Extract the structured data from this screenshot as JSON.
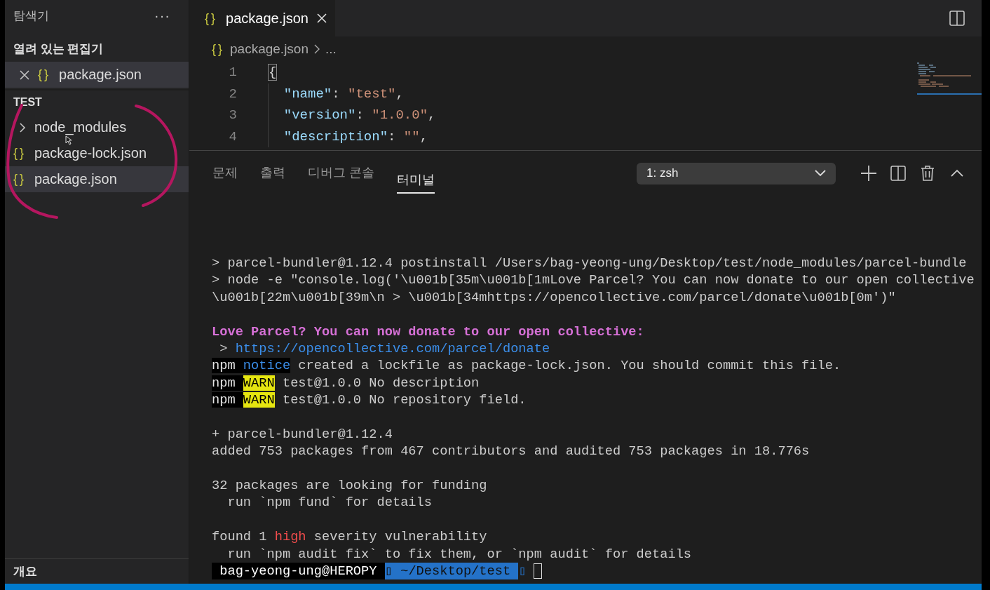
{
  "sidebar": {
    "title": "탐색기",
    "more": "···",
    "open_editors": {
      "title": "열려 있는 편집기",
      "items": [
        {
          "icon": "{}",
          "label": "package.json",
          "selected": true
        }
      ]
    },
    "folder": {
      "title": "TEST",
      "items": [
        {
          "kind": "folder",
          "label": "node_modules",
          "expanded": false,
          "selected": false
        },
        {
          "kind": "file",
          "icon": "{}",
          "label": "package-lock.json",
          "selected": false
        },
        {
          "kind": "file",
          "icon": "{}",
          "label": "package.json",
          "selected": true
        }
      ]
    },
    "outline": {
      "title": "개요"
    }
  },
  "editor": {
    "tabs": [
      {
        "icon": "{}",
        "label": "package.json",
        "selected": true
      }
    ],
    "breadcrumb": {
      "icon": "{}",
      "file": "package.json",
      "rest": "..."
    },
    "lines": [
      {
        "number": "1",
        "tokens": [
          {
            "kind": "bracket-match",
            "text": "{"
          }
        ]
      },
      {
        "number": "2",
        "tokens": [
          {
            "kind": "key",
            "text": "  \"name\""
          },
          {
            "kind": "punct",
            "text": ": "
          },
          {
            "kind": "string",
            "text": "\"test\""
          },
          {
            "kind": "punct",
            "text": ","
          }
        ]
      },
      {
        "number": "3",
        "tokens": [
          {
            "kind": "key",
            "text": "  \"version\""
          },
          {
            "kind": "punct",
            "text": ": "
          },
          {
            "kind": "string",
            "text": "\"1.0.0\""
          },
          {
            "kind": "punct",
            "text": ","
          }
        ]
      },
      {
        "number": "4",
        "tokens": [
          {
            "kind": "key",
            "text": "  \"description\""
          },
          {
            "kind": "punct",
            "text": ": "
          },
          {
            "kind": "string",
            "text": "\"\""
          },
          {
            "kind": "punct",
            "text": ","
          }
        ]
      }
    ]
  },
  "panel": {
    "tabs": [
      {
        "label": "문제",
        "selected": false
      },
      {
        "label": "출력",
        "selected": false
      },
      {
        "label": "디버그 콘솔",
        "selected": false
      },
      {
        "label": "터미널",
        "selected": true
      }
    ],
    "terminal_select": "1: zsh",
    "terminal": {
      "blocks": [
        {
          "lines": [
            {
              "segments": [
                {
                  "kind": "plain",
                  "text": "> parcel-bundler@1.12.4 postinstall /Users/bag-yeong-ung/Desktop/test/node_modules/parcel-bundle"
                }
              ]
            },
            {
              "segments": [
                {
                  "kind": "plain",
                  "text": "> node -e \"console.log('\\u001b[35m\\u001b[1mLove Parcel? You can now donate to our open collective"
                }
              ]
            },
            {
              "segments": [
                {
                  "kind": "plain",
                  "text": "\\u001b[22m\\u001b[39m\\n > \\u001b[34mhttps://opencollective.com/parcel/donate\\u001b[0m')\""
                }
              ]
            }
          ]
        },
        {
          "lines": [
            {
              "segments": [
                {
                  "kind": "heading",
                  "text": "Love Parcel? You can now donate to our open collective:"
                }
              ]
            },
            {
              "segments": [
                {
                  "kind": "plain",
                  "text": " > "
                },
                {
                  "kind": "link",
                  "text": "https://opencollective.com/parcel/donate"
                }
              ]
            },
            {
              "segments": [
                {
                  "kind": "npm",
                  "text": "npm "
                },
                {
                  "kind": "notice",
                  "text": "notice"
                },
                {
                  "kind": "plain",
                  "text": " created a lockfile as package-lock.json. You should commit this file."
                }
              ]
            },
            {
              "segments": [
                {
                  "kind": "npm",
                  "text": "npm "
                },
                {
                  "kind": "warn",
                  "text": "WARN"
                },
                {
                  "kind": "plain",
                  "text": " test@1.0.0 No description"
                }
              ]
            },
            {
              "segments": [
                {
                  "kind": "npm",
                  "text": "npm "
                },
                {
                  "kind": "warn",
                  "text": "WARN"
                },
                {
                  "kind": "plain",
                  "text": " test@1.0.0 No repository field."
                }
              ]
            }
          ]
        },
        {
          "lines": [
            {
              "segments": [
                {
                  "kind": "plain",
                  "text": "+ parcel-bundler@1.12.4"
                }
              ]
            },
            {
              "segments": [
                {
                  "kind": "plain",
                  "text": "added 753 packages from 467 contributors and audited 753 packages in 18.776s"
                }
              ]
            }
          ]
        },
        {
          "lines": [
            {
              "segments": [
                {
                  "kind": "plain",
                  "text": "32 packages are looking for funding"
                }
              ]
            },
            {
              "segments": [
                {
                  "kind": "plain",
                  "text": "  run `npm fund` for details"
                }
              ]
            }
          ]
        },
        {
          "lines": [
            {
              "segments": [
                {
                  "kind": "plain",
                  "text": "found 1 "
                },
                {
                  "kind": "danger",
                  "text": "high"
                },
                {
                  "kind": "plain",
                  "text": " severity vulnerability"
                }
              ]
            },
            {
              "segments": [
                {
                  "kind": "plain",
                  "text": "  run `npm audit fix` to fix them, or `npm audit` for details"
                }
              ]
            }
          ]
        }
      ],
      "prompt": {
        "user": " bag-yeong-ung@HEROPY ",
        "path": "▯ ~/Desktop/test ",
        "separator": "▯"
      }
    }
  }
}
